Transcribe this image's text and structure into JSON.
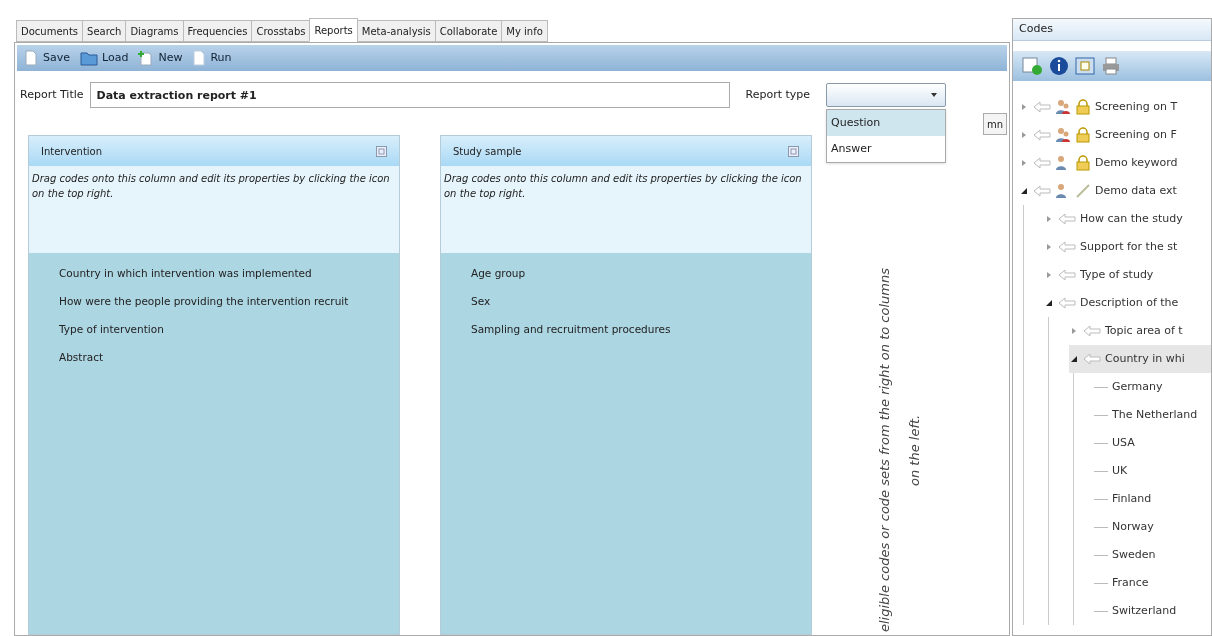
{
  "tabs": [
    {
      "label": "Documents",
      "selected": false
    },
    {
      "label": "Search",
      "selected": false
    },
    {
      "label": "Diagrams",
      "selected": false
    },
    {
      "label": "Frequencies",
      "selected": false
    },
    {
      "label": "Crosstabs",
      "selected": false
    },
    {
      "label": "Reports",
      "selected": true
    },
    {
      "label": "Meta-analysis",
      "selected": false
    },
    {
      "label": "Collaborate",
      "selected": false
    },
    {
      "label": "My info",
      "selected": false
    }
  ],
  "toolbar": [
    {
      "label": "Save",
      "kind": "save"
    },
    {
      "label": "Load",
      "kind": "load"
    },
    {
      "label": "New",
      "kind": "new"
    },
    {
      "label": "Run",
      "kind": "run"
    }
  ],
  "report_title": {
    "label": "Report Title",
    "value": "Data extraction report #1"
  },
  "report_type": {
    "label": "Report type",
    "options": [
      {
        "label": "Question",
        "selected": true
      },
      {
        "label": "Answer",
        "selected": false
      }
    ]
  },
  "add_column_button": "mn",
  "columns": [
    {
      "title": "Intervention",
      "hint": "Drag codes onto this column and edit its properties by clicking the icon on the top right.",
      "items": [
        "Country in which intervention was implemented",
        "How were the people providing the intervention recruit",
        "Type of intervention",
        "Abstract"
      ]
    },
    {
      "title": "Study sample",
      "hint": "Drag codes onto this column and edit its properties by clicking the icon on the top right.",
      "items": [
        "Age group",
        "Sex",
        "Sampling and recruitment procedures"
      ]
    }
  ],
  "instruction": "eligible codes or code sets from the right on to columns on the left.",
  "codes_panel": {
    "title": "Codes",
    "tree": [
      {
        "label": "Screening on T",
        "kind": "group",
        "locked": true,
        "expanded": false,
        "selected": false
      },
      {
        "label": "Screening on F",
        "kind": "group",
        "locked": true,
        "expanded": false,
        "selected": false
      },
      {
        "label": "Demo keyword",
        "kind": "person",
        "locked": true,
        "expanded": false,
        "selected": false
      },
      {
        "label": "Demo data ext",
        "kind": "person",
        "locked": false,
        "expanded": true,
        "selected": false,
        "children": [
          {
            "label": "How can the study",
            "kind": "code",
            "expanded": false,
            "selected": false
          },
          {
            "label": "Support for the st",
            "kind": "code",
            "expanded": false,
            "selected": false
          },
          {
            "label": "Type of study",
            "kind": "code",
            "expanded": false,
            "selected": false
          },
          {
            "label": "Description of the",
            "kind": "code",
            "expanded": true,
            "selected": false,
            "children": [
              {
                "label": "Topic area of t",
                "kind": "code",
                "expanded": false,
                "selected": false
              },
              {
                "label": "Country in whi",
                "kind": "code",
                "expanded": true,
                "selected": true,
                "children": [
                  {
                    "label": "Germany",
                    "kind": "leaf",
                    "selected": false
                  },
                  {
                    "label": "The Netherland",
                    "kind": "leaf",
                    "selected": false
                  },
                  {
                    "label": "USA",
                    "kind": "leaf",
                    "selected": false
                  },
                  {
                    "label": "UK",
                    "kind": "leaf",
                    "selected": false
                  },
                  {
                    "label": "Finland",
                    "kind": "leaf",
                    "selected": false
                  },
                  {
                    "label": "Norway",
                    "kind": "leaf",
                    "selected": false
                  },
                  {
                    "label": "Sweden",
                    "kind": "leaf",
                    "selected": false
                  },
                  {
                    "label": "France",
                    "kind": "leaf",
                    "selected": false
                  },
                  {
                    "label": "Switzerland",
                    "kind": "leaf",
                    "selected": false
                  }
                ]
              }
            ]
          }
        ]
      }
    ]
  }
}
